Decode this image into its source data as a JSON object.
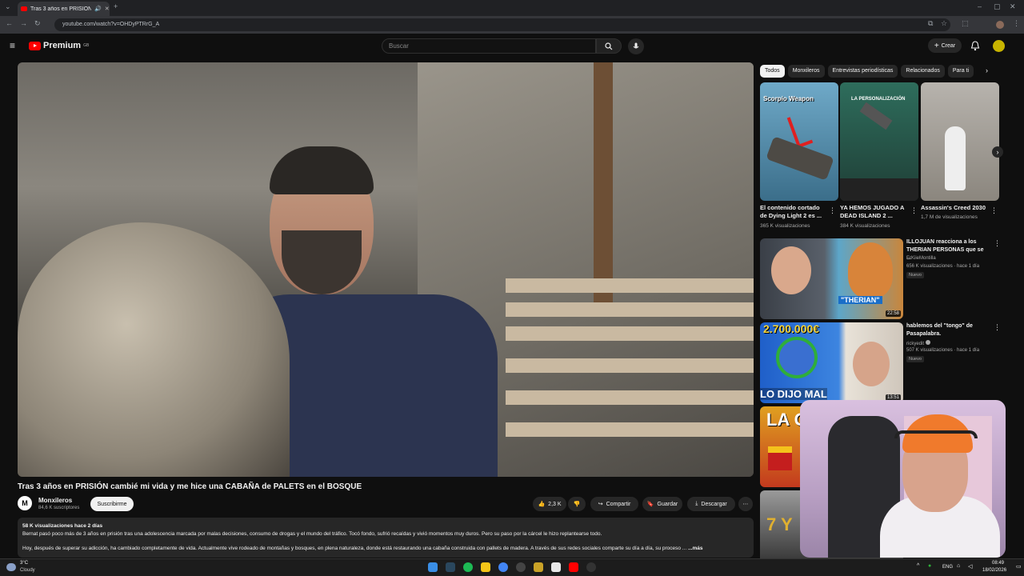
{
  "browser": {
    "tab_title": "Tras 3 años en PRISIÓN ca",
    "url": "youtube.com/watch?v=OHDyPTRrG_A"
  },
  "masthead": {
    "logo_text": "Premium",
    "logo_badge": "GB",
    "search_placeholder": "Buscar",
    "create_label": "Crear"
  },
  "video": {
    "title": "Tras 3 años en PRISIÓN cambié mi vida y me hice una CABAÑA de PALETS en el BOSQUE",
    "channel": {
      "name": "Monxileros",
      "subscribers": "84,6 K suscriptores",
      "avatar_letter": "M"
    },
    "subscribe_label": "Suscribirme",
    "actions": {
      "likes": "2,3 K",
      "share": "Compartir",
      "save": "Guardar",
      "download": "Descargar"
    },
    "description": {
      "stats": "58 K visualizaciones  hace 2 días",
      "line1": "Bernat pasó poco más de 3 años en prisión tras una adolescencia marcada por malas decisiones, consumo de drogas y el mundo del tráfico. Tocó fondo, sufrió recaídas y vivió momentos muy duros. Pero su paso por la cárcel le hizo replantearse todo.",
      "line2": "Hoy, después de superar su adicción, ha cambiado completamente de vida. Actualmente vive rodeado de montañas y bosques, en plena naturaleza, donde está restaurando una cabaña construida con pallets de madera. A través de sus redes sociales comparte su día a día, su proceso ...",
      "more": "...más"
    }
  },
  "sidebar": {
    "chips": [
      "Todos",
      "Monxileros",
      "Entrevistas periodísticas",
      "Relacionados",
      "Para ti"
    ],
    "shorts": [
      {
        "title": "El contenido cortado de Dying Light 2 es ...",
        "views": "365 K visualizaciones",
        "thumb_text": "Scorpio Weapon"
      },
      {
        "title": "YA HEMOS JUGADO A DEAD ISLAND 2 ...",
        "views": "384 K visualizaciones",
        "thumb_text": "LA PERSONALIZACIÓN"
      },
      {
        "title": "Assassin's Creed 2030",
        "views": "1,7 M de visualizaciones",
        "thumb_text": ""
      }
    ],
    "recommendations": [
      {
        "title": "ILLOJUAN reacciona a los THERIAN PERSONAS que se ...",
        "channel": "ErKiieMontilla",
        "meta": "656 K visualizaciones · hace 1 día",
        "badge": "Nuevo",
        "duration": "22:58",
        "thumb_text": "\"THERIAN\""
      },
      {
        "title": "hablemos del \"tongo\" de Pasapalabra.",
        "channel": "rickyedit",
        "meta": "507 K visualizaciones · hace 1 día",
        "badge": "Nuevo",
        "duration": "13:51",
        "thumb_text": "LO DIJO MAL",
        "thumb_top": "2.700.000€"
      },
      {
        "thumb_text": "LA G"
      },
      {
        "thumb_text": "7 Y"
      }
    ]
  },
  "taskbar": {
    "temp": "3°C",
    "condition": "Cloudy",
    "lang": "ENG",
    "time": "08:49",
    "date": "18/02/2026"
  },
  "colors": {
    "youtube_red": "#ff0000",
    "background": "#0f0f0f"
  }
}
